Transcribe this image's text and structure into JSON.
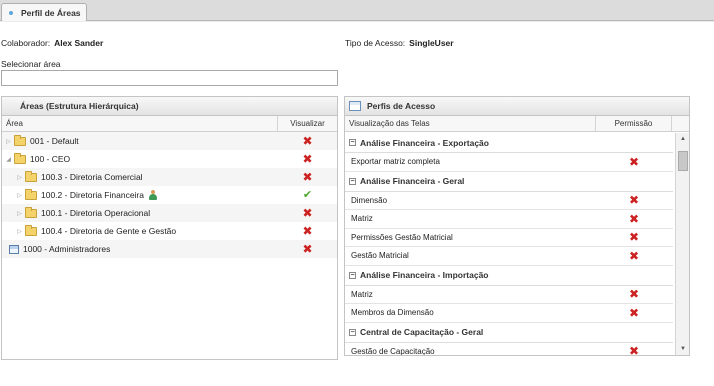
{
  "tab": {
    "label": "Perfil de Áreas"
  },
  "info": {
    "colaborador_label": "Colaborador:",
    "colaborador_value": "Alex Sander",
    "tipo_label": "Tipo de Acesso:",
    "tipo_value": "SingleUser"
  },
  "select_area": {
    "label": "Selecionar área",
    "value": ""
  },
  "left_panel": {
    "title": "Áreas (Estrutura Hierárquica)",
    "col_area": "Área",
    "col_visualizar": "Visualizar",
    "rows": [
      {
        "label": "001 - Default",
        "icon": "folder-icon",
        "state": "collapsed",
        "visualizar": "x"
      },
      {
        "label": "100 - CEO",
        "icon": "folder-icon",
        "state": "expanded",
        "visualizar": "x"
      },
      {
        "label": "100.3 - Diretoria Comercial",
        "icon": "folder-icon",
        "state": "collapsed",
        "visualizar": "x"
      },
      {
        "label": "100.2 - Diretoria Financeira",
        "icon": "folder-icon",
        "state": "collapsed",
        "visualizar": "check"
      },
      {
        "label": "100.1 - Diretoria Operacional",
        "icon": "folder-icon",
        "state": "collapsed",
        "visualizar": "x"
      },
      {
        "label": "100.4 - Diretoria de Gente e Gestão",
        "icon": "folder-icon",
        "state": "collapsed",
        "visualizar": "x"
      },
      {
        "label": "1000 - Administradores",
        "icon": "admin-icon",
        "state": "leaf",
        "visualizar": "x"
      }
    ]
  },
  "right_panel": {
    "title": "Perfis de Acesso",
    "col_telas": "Visualização das Telas",
    "col_permissao": "Permissão",
    "groups": [
      {
        "name": "Análise Financeira - Exportação",
        "items": [
          "Exportar matriz completa"
        ]
      },
      {
        "name": "Análise Financeira - Geral",
        "items": [
          "Dimensão",
          "Matriz",
          "Permissões Gestão Matricial",
          "Gestão Matricial"
        ]
      },
      {
        "name": "Análise Financeira - Importação",
        "items": [
          "Matriz",
          "Membros da Dimensão"
        ]
      },
      {
        "name": "Central de Capacitação - Geral",
        "items": [
          "Gestão de Capacitação"
        ]
      }
    ]
  },
  "colors": {
    "deny": "#cc2222",
    "allow": "#4aa52d",
    "accent": "#5fa6d8"
  }
}
